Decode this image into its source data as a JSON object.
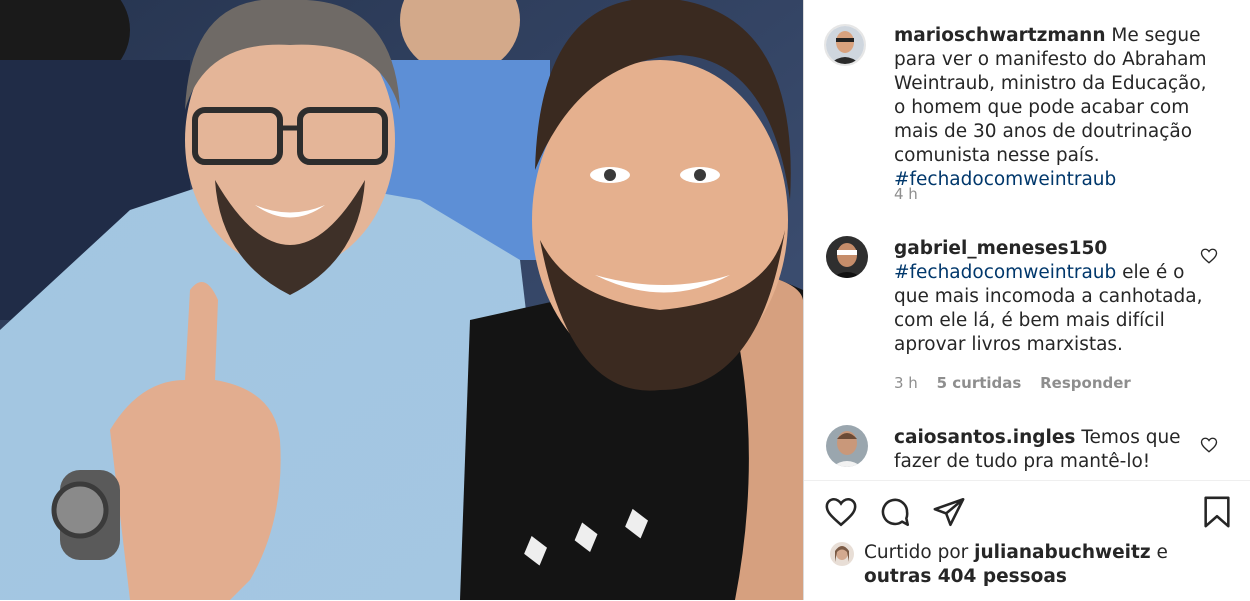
{
  "caption": {
    "username": "marioschwartzmann",
    "text": "Me segue para ver o manifesto do Abraham Weintraub, ministro da Educação, o homem que pode acabar com mais de 30 anos de doutrinação comunista nesse país.",
    "hashtag": "#fechadocomweintraub",
    "time": "4 h"
  },
  "comments": [
    {
      "username": "gabriel_meneses150",
      "hashtag": "#fechadocomweintraub",
      "text": "ele é o que mais incomoda a canhotada, com ele lá, é bem mais difícil aprovar livros marxistas.",
      "time": "3 h",
      "likes": "5 curtidas",
      "reply": "Responder"
    },
    {
      "username": "caiosantos.ingles",
      "text": "Temos que fazer de tudo pra mantê-lo!"
    }
  ],
  "liked_by": {
    "prefix": "Curtido por",
    "user": "julianabuchweitz",
    "conj": "e",
    "others": "outras 404 pessoas"
  },
  "icons": {
    "like": "heart-icon",
    "comment": "comment-icon",
    "share": "send-icon",
    "save": "bookmark-icon"
  }
}
